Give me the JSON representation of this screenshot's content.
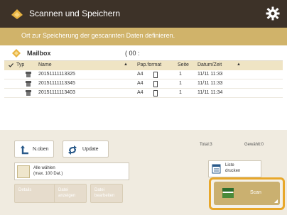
{
  "titlebar": {
    "title": "Scannen und Speichern"
  },
  "infobar": {
    "message": "Ort zur Speicherung der gescannten Daten definieren."
  },
  "mailbox": {
    "label": "Mailbox",
    "number": "( 00 :"
  },
  "table": {
    "headers": {
      "typ": "Typ",
      "name": "Name",
      "papformat": "Pap.format",
      "seite": "Seite",
      "datumzeit": "Datum/Zeit"
    },
    "rows": [
      {
        "name": "20151111113325",
        "format": "A4",
        "pages": "1",
        "date": "11/11 11:33"
      },
      {
        "name": "20151111113345",
        "format": "A4",
        "pages": "1",
        "date": "11/11 11:33"
      },
      {
        "name": "20151111113403",
        "format": "A4",
        "pages": "1",
        "date": "11/11 11:34"
      }
    ]
  },
  "toolbar": {
    "back_label": "N.oben",
    "update_label": "Update"
  },
  "status": {
    "total": "Total:3",
    "selected": "Gewählt:0"
  },
  "select_all": {
    "line1": "Alle wählen",
    "line2": "(max. 100 Dat.)"
  },
  "print_list": {
    "line1": "Liste",
    "line2": "drucken"
  },
  "disabled_buttons": [
    {
      "line1": "Details",
      "line2": ""
    },
    {
      "line1": "Datei",
      "line2": "anzeigen"
    },
    {
      "line1": "Datei",
      "line2": "bearbeiten"
    }
  ],
  "scan_button": {
    "label": "Scan"
  },
  "colors": {
    "titlebar": "#3d3228",
    "infobar": "#d0b36a",
    "accent": "#cab070",
    "focus": "#e8a72a"
  }
}
